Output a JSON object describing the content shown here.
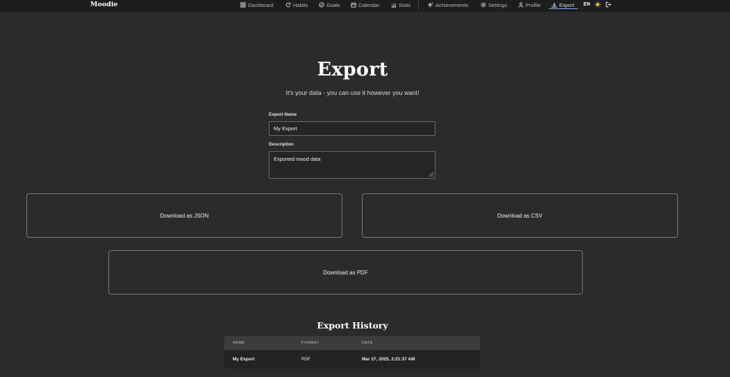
{
  "app": {
    "brand": "Moodie"
  },
  "nav": {
    "items": [
      {
        "label": "Dashboard",
        "icon": "dashboard-icon"
      },
      {
        "label": "Habits",
        "icon": "refresh-icon"
      },
      {
        "label": "Goals",
        "icon": "check-circle-icon"
      },
      {
        "label": "Calendar",
        "icon": "calendar-icon"
      },
      {
        "label": "Stats",
        "icon": "bar-chart-icon"
      },
      {
        "label": "Achievements",
        "icon": "sparkles-icon"
      },
      {
        "label": "Settings",
        "icon": "gear-icon"
      },
      {
        "label": "Profile",
        "icon": "user-icon"
      },
      {
        "label": "Export",
        "icon": "download-icon"
      }
    ],
    "active": "Export",
    "language": "EN",
    "accent_color": "#7aa7ff"
  },
  "page": {
    "title": "Export",
    "subtitle": "It's your data - you can use it however you want!"
  },
  "form": {
    "name_label": "Export Name",
    "name_value": "My Export",
    "description_label": "Description",
    "description_value": "Exported mood data"
  },
  "buttons": {
    "json": "Download as JSON",
    "csv": "Download as CSV",
    "pdf": "Download as PDF"
  },
  "history": {
    "title": "Export History",
    "columns": [
      "NAME",
      "FORMAT",
      "DATE"
    ],
    "rows": [
      {
        "name": "My Export",
        "format": "PDF",
        "date": "Mar 27, 2025, 2:21:37 AM"
      }
    ]
  }
}
